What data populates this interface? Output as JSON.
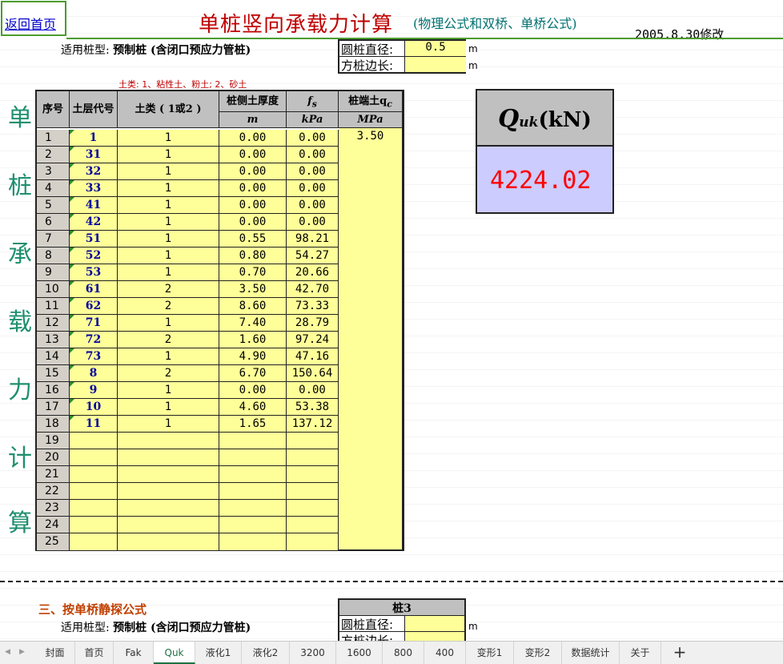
{
  "header": {
    "back_link": "返回首页",
    "title": "单桩竖向承载力计算",
    "subtitle": "(物理公式和双桥、单桥公式)",
    "date": "2005.8.30修改"
  },
  "pile_type": {
    "label": "适用桩型:",
    "value": "预制桩 (含闭口预应力管桩)"
  },
  "params": {
    "round_dia_label": "圆桩直径:",
    "round_dia_value": "0.5",
    "square_side_label": "方桩边长:",
    "square_side_value": "",
    "unit_m": "m"
  },
  "soil_note": "土类: 1、粘性土、粉土;  2、砂土",
  "vertical_title": [
    "单",
    "桩",
    "承",
    "载",
    "力",
    "计",
    "算"
  ],
  "table": {
    "headers": {
      "no": "序号",
      "code": "土层代号",
      "type": "土类 ( 1或2 )",
      "thickness": "桩侧土厚度",
      "thickness_unit": "m",
      "fs": "f",
      "fs_sub": "s",
      "fs_unit": "kPa",
      "qc": "桩端土q",
      "qc_sub": "c",
      "qc_unit": "MPa"
    },
    "qc_value": "3.50",
    "rows": [
      {
        "no": "1",
        "code": "1",
        "type": "1",
        "thk": "0.00",
        "fs": "0.00"
      },
      {
        "no": "2",
        "code": "31",
        "type": "1",
        "thk": "0.00",
        "fs": "0.00"
      },
      {
        "no": "3",
        "code": "32",
        "type": "1",
        "thk": "0.00",
        "fs": "0.00"
      },
      {
        "no": "4",
        "code": "33",
        "type": "1",
        "thk": "0.00",
        "fs": "0.00"
      },
      {
        "no": "5",
        "code": "41",
        "type": "1",
        "thk": "0.00",
        "fs": "0.00"
      },
      {
        "no": "6",
        "code": "42",
        "type": "1",
        "thk": "0.00",
        "fs": "0.00"
      },
      {
        "no": "7",
        "code": "51",
        "type": "1",
        "thk": "0.55",
        "fs": "98.21"
      },
      {
        "no": "8",
        "code": "52",
        "type": "1",
        "thk": "0.80",
        "fs": "54.27"
      },
      {
        "no": "9",
        "code": "53",
        "type": "1",
        "thk": "0.70",
        "fs": "20.66"
      },
      {
        "no": "10",
        "code": "61",
        "type": "2",
        "thk": "3.50",
        "fs": "42.70"
      },
      {
        "no": "11",
        "code": "62",
        "type": "2",
        "thk": "8.60",
        "fs": "73.33"
      },
      {
        "no": "12",
        "code": "71",
        "type": "1",
        "thk": "7.40",
        "fs": "28.79"
      },
      {
        "no": "13",
        "code": "72",
        "type": "2",
        "thk": "1.60",
        "fs": "97.24"
      },
      {
        "no": "14",
        "code": "73",
        "type": "1",
        "thk": "4.90",
        "fs": "47.16"
      },
      {
        "no": "15",
        "code": "8",
        "type": "2",
        "thk": "6.70",
        "fs": "150.64"
      },
      {
        "no": "16",
        "code": "9",
        "type": "1",
        "thk": "0.00",
        "fs": "0.00"
      },
      {
        "no": "17",
        "code": "10",
        "type": "1",
        "thk": "4.60",
        "fs": "53.38"
      },
      {
        "no": "18",
        "code": "11",
        "type": "1",
        "thk": "1.65",
        "fs": "137.12"
      },
      {
        "no": "19",
        "code": "",
        "type": "",
        "thk": "",
        "fs": ""
      },
      {
        "no": "20",
        "code": "",
        "type": "",
        "thk": "",
        "fs": ""
      },
      {
        "no": "21",
        "code": "",
        "type": "",
        "thk": "",
        "fs": ""
      },
      {
        "no": "22",
        "code": "",
        "type": "",
        "thk": "",
        "fs": ""
      },
      {
        "no": "23",
        "code": "",
        "type": "",
        "thk": "",
        "fs": ""
      },
      {
        "no": "24",
        "code": "",
        "type": "",
        "thk": "",
        "fs": ""
      },
      {
        "no": "25",
        "code": "",
        "type": "",
        "thk": "",
        "fs": ""
      }
    ]
  },
  "result": {
    "q": "Q",
    "q_sub": "uk",
    "unit": "(kN)",
    "value": "4224.02"
  },
  "section3": {
    "title": "三、按单桥静探公式",
    "pile_label": "适用桩型:",
    "pile_value": "预制桩 (含闭口预应力管桩)",
    "box_title": "桩3",
    "round_dia_label": "圆桩直径:",
    "square_side_label": "方桩边长:",
    "unit_m": "m"
  },
  "tabs": [
    "封面",
    "首页",
    "Fak",
    "Quk",
    "液化1",
    "液化2",
    "3200",
    "1600",
    "800",
    "400",
    "变形1",
    "变形2",
    "数据统计",
    "关于"
  ],
  "active_tab": "Quk",
  "colors": {
    "yellow_cell": "#ffff99",
    "header_gray": "#c0c0c0",
    "result_bg": "#ccccff",
    "result_text": "#ff0000",
    "title_red": "#c00000",
    "vertical_green": "#1f8f6f"
  }
}
